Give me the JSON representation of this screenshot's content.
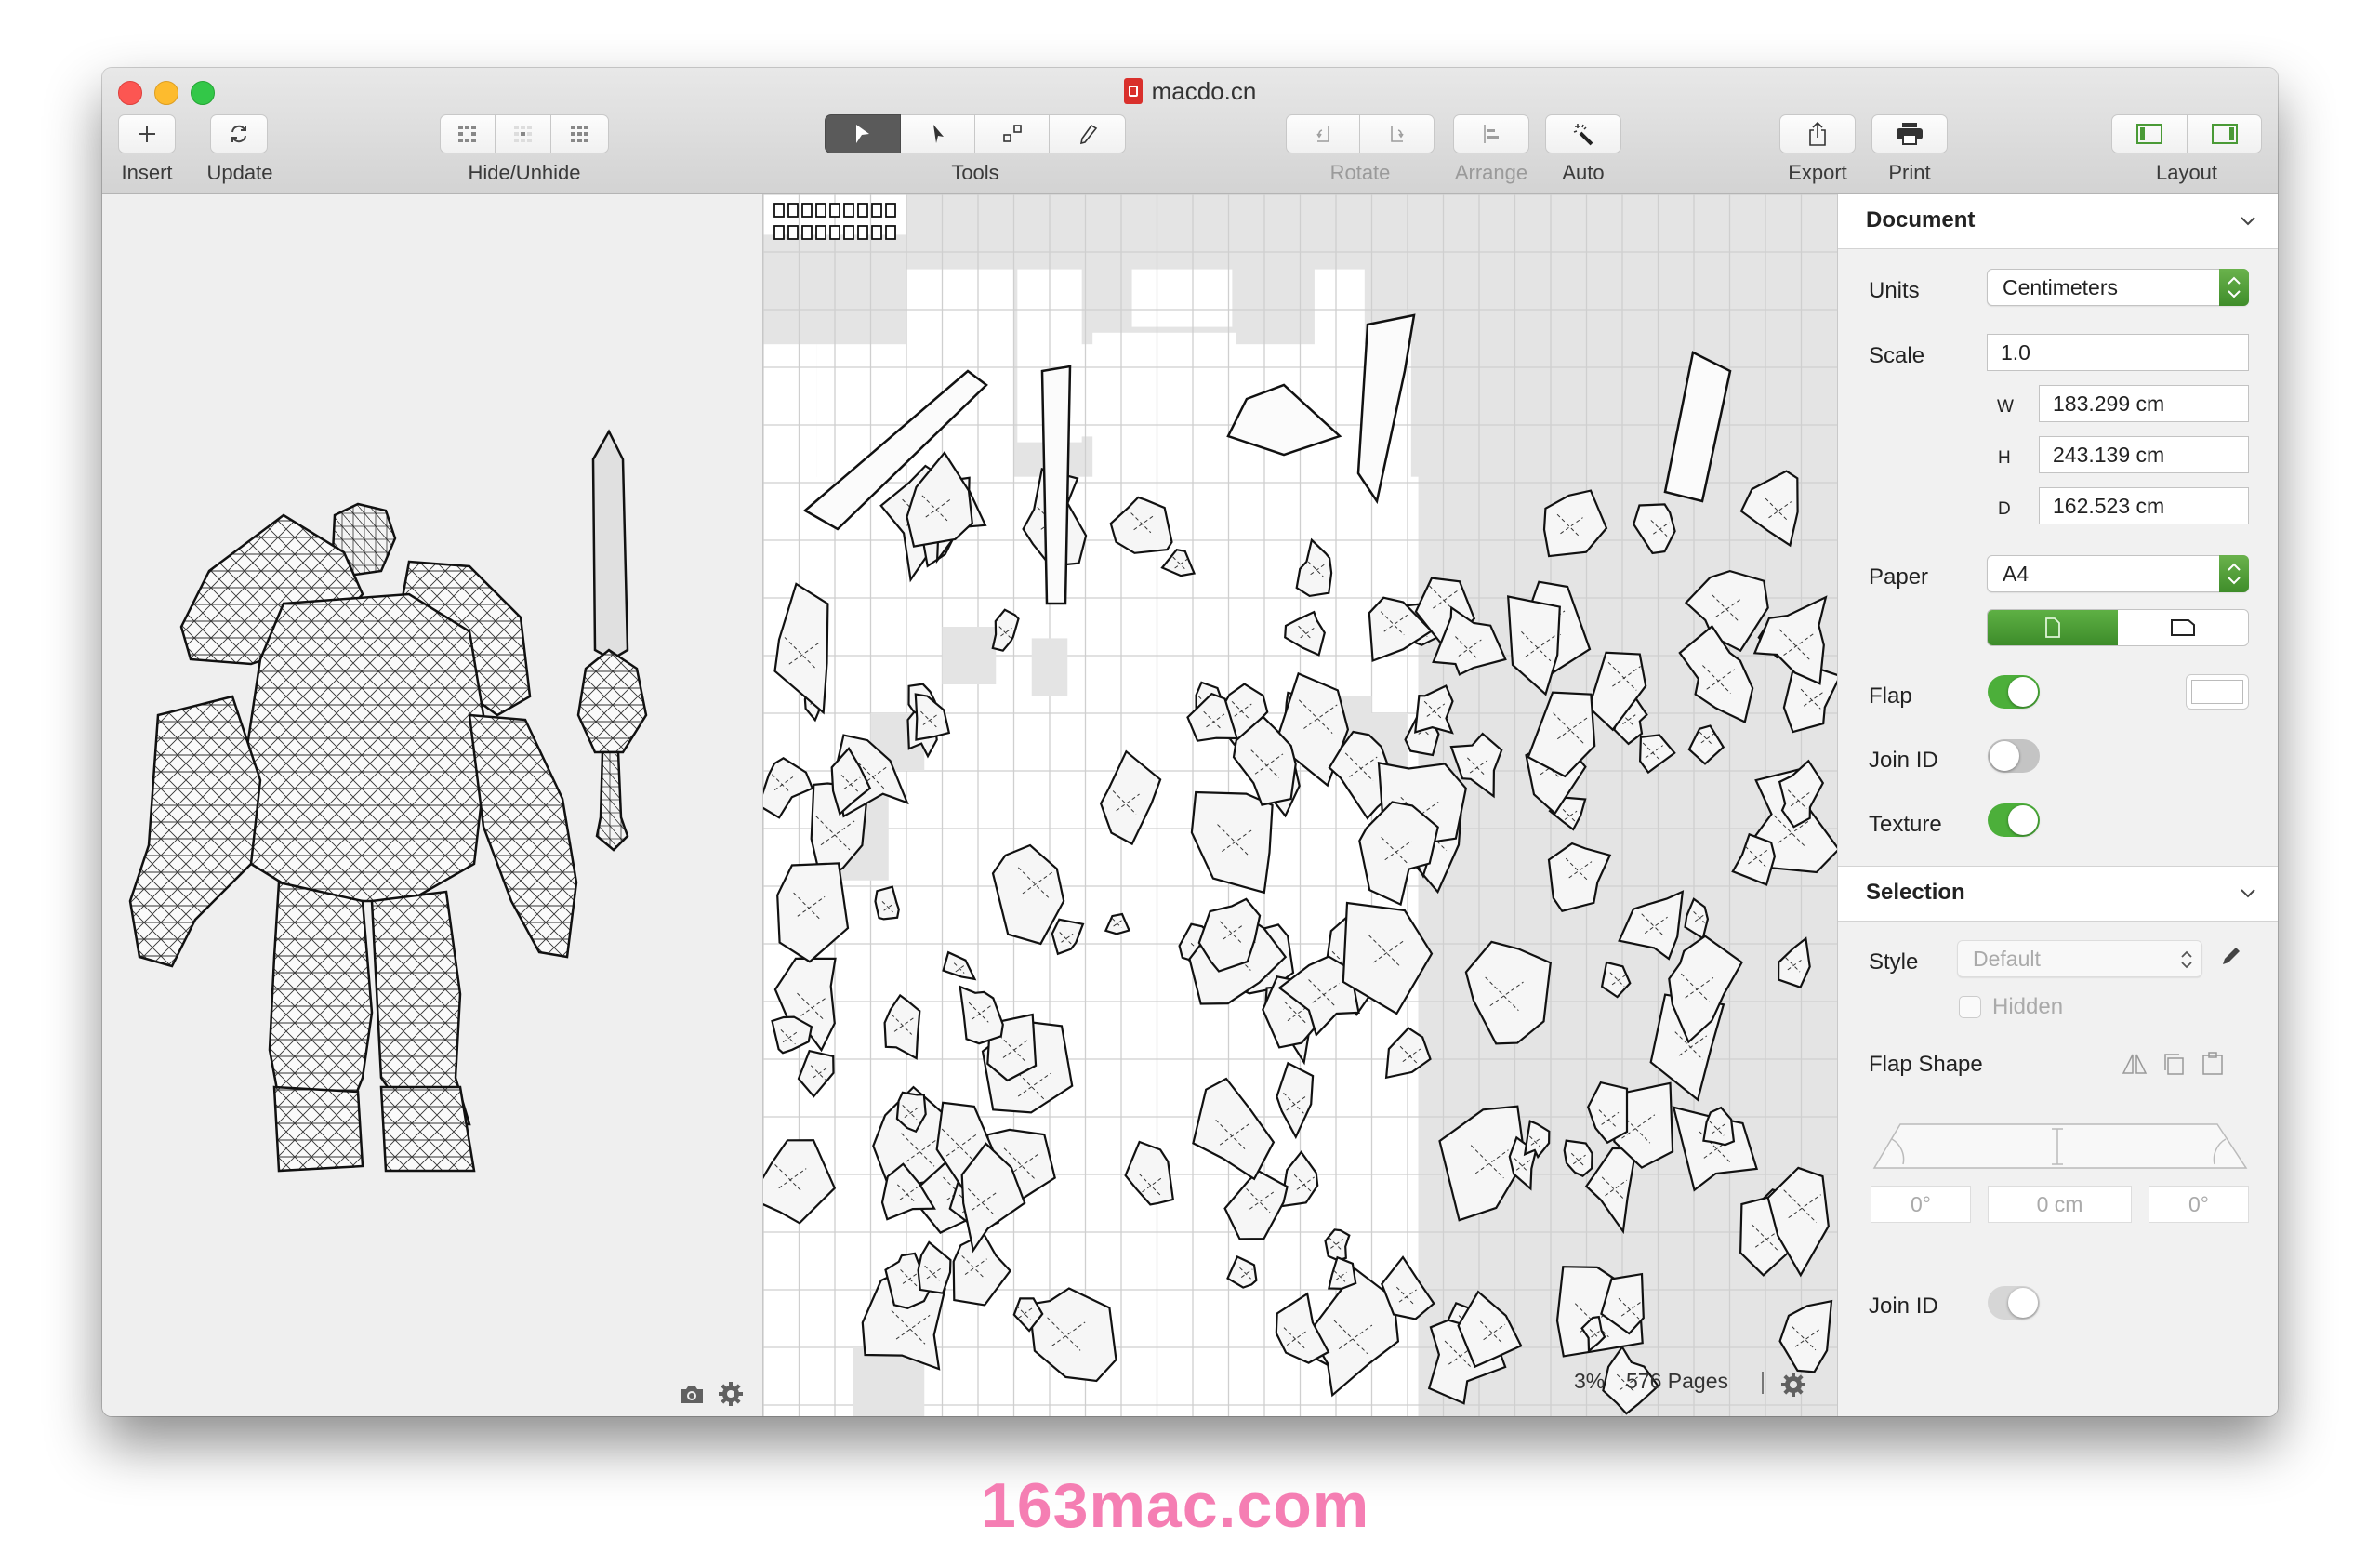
{
  "window": {
    "title": "macdo.cn",
    "title_icon": "document-app-icon"
  },
  "toolbar": {
    "insert": {
      "label": "Insert",
      "icon": "plus-icon"
    },
    "update": {
      "label": "Update",
      "icon": "refresh-icon"
    },
    "hide_unhide": {
      "label": "Hide/Unhide",
      "buttons": [
        "hide-selected-icon",
        "hide-unselected-icon",
        "unhide-all-icon"
      ]
    },
    "tools": {
      "label": "Tools",
      "buttons": [
        "select-arrow-icon",
        "direct-select-arrow-icon",
        "join-pieces-icon",
        "edge-tool-icon"
      ],
      "active_index": 0
    },
    "rotate": {
      "label": "Rotate",
      "buttons": [
        "rotate-left-icon",
        "rotate-right-icon"
      ],
      "enabled": false
    },
    "arrange": {
      "label": "Arrange",
      "icon": "align-left-icon",
      "enabled": false
    },
    "auto": {
      "label": "Auto",
      "icon": "magic-wand-icon"
    },
    "export": {
      "label": "Export",
      "icon": "share-icon"
    },
    "print": {
      "label": "Print",
      "icon": "printer-icon"
    },
    "layout": {
      "label": "Layout",
      "buttons": [
        "left-sidebar-icon",
        "right-sidebar-icon"
      ]
    }
  },
  "left_pane": {
    "content": "3D wireframe model: armored warrior and sword",
    "footer_icons": [
      "camera-icon",
      "gear-icon"
    ]
  },
  "canvas": {
    "content": "Unfolded paper-craft pattern pieces laid out on A4 page grid",
    "status": {
      "zoom": "3%",
      "pages": "576 Pages"
    }
  },
  "inspector": {
    "document": {
      "title": "Document",
      "units_label": "Units",
      "units_value": "Centimeters",
      "scale_label": "Scale",
      "scale_value": "1.0",
      "w_label": "W",
      "w_value": "183.299 cm",
      "h_label": "H",
      "h_value": "243.139 cm",
      "d_label": "D",
      "d_value": "162.523 cm",
      "paper_label": "Paper",
      "paper_value": "A4",
      "orientation": {
        "options": [
          "portrait",
          "landscape"
        ],
        "selected": "portrait"
      },
      "flap_label": "Flap",
      "flap_on": true,
      "join_id_label": "Join ID",
      "join_id_on": false,
      "texture_label": "Texture",
      "texture_on": true
    },
    "selection": {
      "title": "Selection",
      "style_label": "Style",
      "style_value": "Default",
      "hidden_label": "Hidden",
      "hidden_checked": false,
      "flap_shape_label": "Flap Shape",
      "flap_left_angle": "0°",
      "flap_height": "0 cm",
      "flap_right_angle": "0°",
      "join_id_label": "Join ID"
    }
  },
  "accent_color": "#4caf3a",
  "watermark": "163mac.com"
}
